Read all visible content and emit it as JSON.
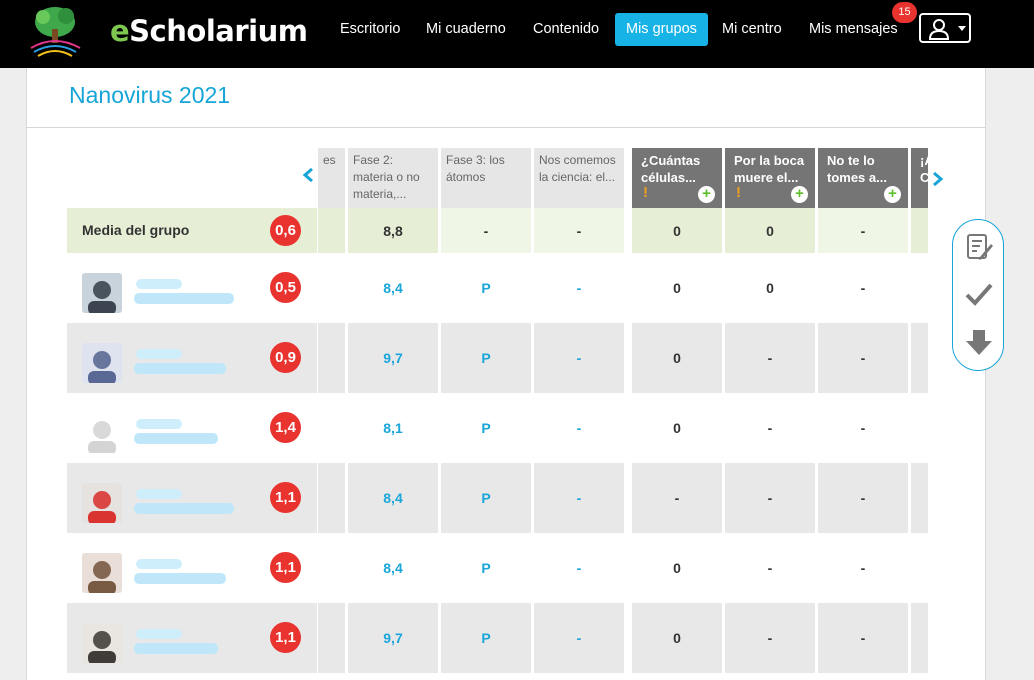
{
  "app": {
    "name_prefix": "e",
    "name_rest": "Scholarium"
  },
  "nav": {
    "items": [
      {
        "label": "Escritorio",
        "active": false
      },
      {
        "label": "Mi cuaderno",
        "active": false
      },
      {
        "label": "Contenido",
        "active": false
      },
      {
        "label": "Mis grupos",
        "active": true
      },
      {
        "label": "Mi centro",
        "active": false
      },
      {
        "label": "Mis mensajes",
        "active": false
      }
    ],
    "messages_badge": "15"
  },
  "page": {
    "title": "Nanovirus 2021"
  },
  "table": {
    "columns": [
      {
        "label": "es",
        "style": "grey"
      },
      {
        "label": "Fase 2: materia o no materia,...",
        "style": "grey"
      },
      {
        "label": "Fase 3: los átomos",
        "style": "grey"
      },
      {
        "label": "Nos comemos la ciencia: el...",
        "style": "grey"
      },
      {
        "label": "¿Cuántas células...",
        "style": "dark",
        "warning": "!",
        "add": "+"
      },
      {
        "label": "Por la boca muere el...",
        "style": "dark",
        "warning": "!",
        "add": "+"
      },
      {
        "label": "No te lo tomes a...",
        "style": "dark",
        "add": "+"
      },
      {
        "label": "¡A C",
        "style": "dark"
      }
    ],
    "mean_row": {
      "label": "Media del grupo",
      "score": "0,6",
      "values": [
        "8,8",
        "-",
        "-",
        "0",
        "0",
        "-"
      ]
    },
    "students": [
      {
        "score": "0,5",
        "values": [
          "8,4",
          "P",
          "-",
          "0",
          "0",
          "-"
        ]
      },
      {
        "score": "0,9",
        "values": [
          "9,7",
          "P",
          "-",
          "0",
          "-",
          "-"
        ]
      },
      {
        "score": "1,4",
        "values": [
          "8,1",
          "P",
          "-",
          "0",
          "-",
          "-"
        ]
      },
      {
        "score": "1,1",
        "values": [
          "8,4",
          "P",
          "-",
          "-",
          "-",
          "-"
        ]
      },
      {
        "score": "1,1",
        "values": [
          "8,4",
          "P",
          "-",
          "0",
          "-",
          "-"
        ]
      },
      {
        "score": "1,1",
        "values": [
          "9,7",
          "P",
          "-",
          "0",
          "-",
          "-"
        ]
      }
    ]
  },
  "colors": {
    "accent": "#17b3e6",
    "score_badge": "#e8332f",
    "mean_row": "#e9f2da",
    "dark_header": "#757575"
  }
}
